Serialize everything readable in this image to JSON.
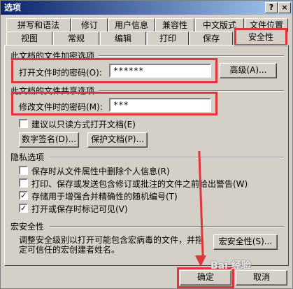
{
  "window": {
    "title": "选项",
    "help_btn": "?",
    "close_btn": "×"
  },
  "tabs_row1": [
    "拼写和语法",
    "修订",
    "用户信息",
    "兼容性",
    "中文版式",
    "文件位置"
  ],
  "tabs_row2": [
    "视图",
    "常规",
    "编辑",
    "打印",
    "保存",
    "安全性"
  ],
  "encrypt": {
    "section": "此文档的文件加密选项",
    "open_label": "打开文件时的密码(O):",
    "open_value": "******",
    "advanced_btn": "高级(A)..."
  },
  "share": {
    "section": "此文档的文件共享选项",
    "modify_label": "修改文件时的密码(M):",
    "modify_value": "***",
    "readonly_label": "建议以只读方式打开文档(E)",
    "readonly_checked": "",
    "digital_sig_btn": "数字签名(D)...",
    "protect_btn": "保护文档(P)..."
  },
  "privacy": {
    "section": "隐私选项",
    "items": [
      {
        "label": "保存时从文件属性中删除个人信息(R)",
        "check": ""
      },
      {
        "label": "打印、保存或发送包含修订或批注的文件之前给出警告(W)",
        "check": ""
      },
      {
        "label": "存储用于增强合并精确性的随机编号(T)",
        "check": "✓"
      },
      {
        "label": "打开或保存时标记可见(V)",
        "check": "✓"
      }
    ]
  },
  "macro": {
    "section": "宏安全性",
    "desc_line1": "调整安全级别以打开可能包含宏病毒的文件，并指",
    "desc_line2": "定可信任的宏创建者姓名。",
    "btn": "宏安全性(S)..."
  },
  "footer": {
    "ok": "确定",
    "cancel": "取消"
  },
  "watermark": "Bai 经验",
  "colors": {
    "highlight": "#e0353a",
    "title_bar": "#0a246a",
    "face": "#d4d0c8"
  }
}
